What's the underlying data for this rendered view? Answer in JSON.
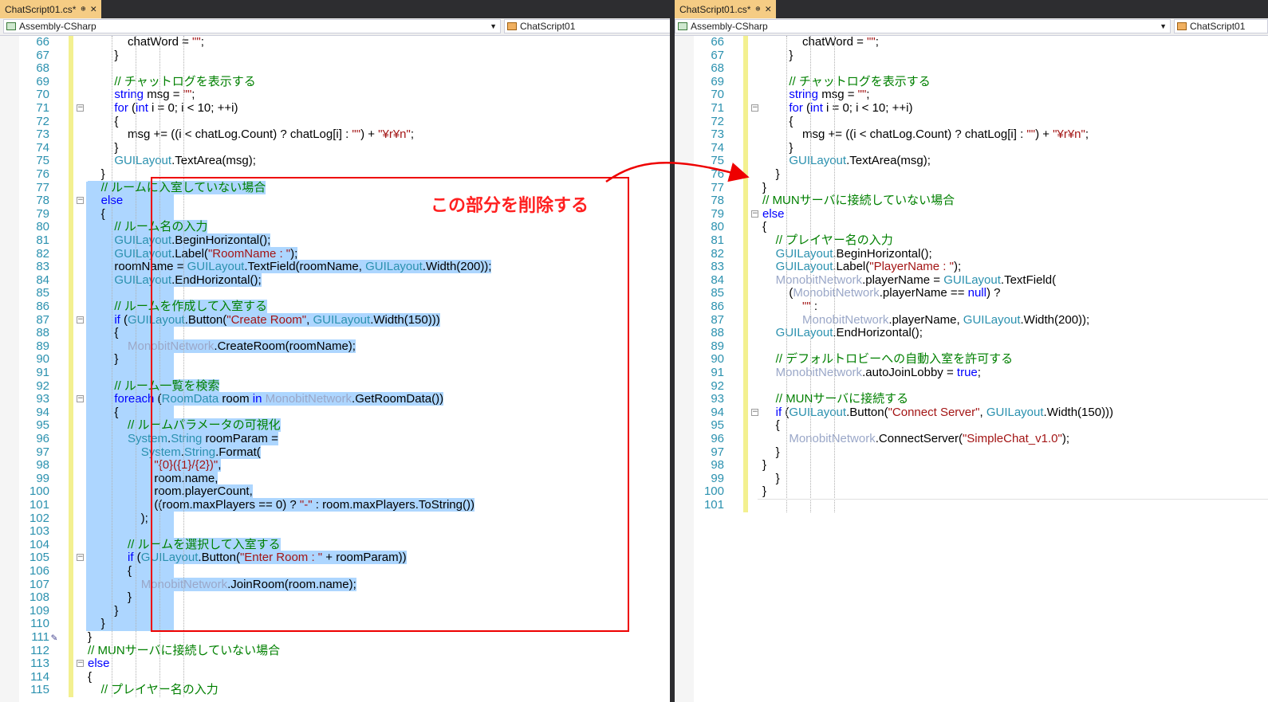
{
  "left": {
    "tab": {
      "title": "ChatScript01.cs*",
      "pin": "⊕",
      "close": "✕"
    },
    "nav": {
      "assembly": "Assembly-CSharp",
      "class": "ChatScript01"
    },
    "lines": [
      {
        "n": "66",
        "t": "            chatWord = \"\";"
      },
      {
        "n": "67",
        "t": "        }"
      },
      {
        "n": "68",
        "t": ""
      },
      {
        "n": "69",
        "t": "        // チャットログを表示する"
      },
      {
        "n": "70",
        "t": "        string msg = \"\";"
      },
      {
        "n": "71",
        "t": "        for (int i = 0; i < 10; ++i)"
      },
      {
        "n": "72",
        "t": "        {"
      },
      {
        "n": "73",
        "t": "            msg += ((i < chatLog.Count) ? chatLog[i] : \"\") + \"¥r¥n\";"
      },
      {
        "n": "74",
        "t": "        }"
      },
      {
        "n": "75",
        "t": "        GUILayout.TextArea(msg);"
      },
      {
        "n": "76",
        "t": "    }"
      },
      {
        "n": "77",
        "t": "    // ルームに入室していない場合"
      },
      {
        "n": "78",
        "t": "    else"
      },
      {
        "n": "79",
        "t": "    {"
      },
      {
        "n": "80",
        "t": "        // ルーム名の入力"
      },
      {
        "n": "81",
        "t": "        GUILayout.BeginHorizontal();"
      },
      {
        "n": "82",
        "t": "        GUILayout.Label(\"RoomName : \");"
      },
      {
        "n": "83",
        "t": "        roomName = GUILayout.TextField(roomName, GUILayout.Width(200));"
      },
      {
        "n": "84",
        "t": "        GUILayout.EndHorizontal();"
      },
      {
        "n": "85",
        "t": ""
      },
      {
        "n": "86",
        "t": "        // ルームを作成して入室する"
      },
      {
        "n": "87",
        "t": "        if (GUILayout.Button(\"Create Room\", GUILayout.Width(150)))"
      },
      {
        "n": "88",
        "t": "        {"
      },
      {
        "n": "89",
        "t": "            MonobitNetwork.CreateRoom(roomName);"
      },
      {
        "n": "90",
        "t": "        }"
      },
      {
        "n": "91",
        "t": ""
      },
      {
        "n": "92",
        "t": "        // ルーム一覧を検索"
      },
      {
        "n": "93",
        "t": "        foreach (RoomData room in MonobitNetwork.GetRoomData())"
      },
      {
        "n": "94",
        "t": "        {"
      },
      {
        "n": "95",
        "t": "            // ルームパラメータの可視化"
      },
      {
        "n": "96",
        "t": "            System.String roomParam ="
      },
      {
        "n": "97",
        "t": "                System.String.Format("
      },
      {
        "n": "98",
        "t": "                    \"{0}({1}/{2})\","
      },
      {
        "n": "99",
        "t": "                    room.name,"
      },
      {
        "n": "100",
        "t": "                    room.playerCount,"
      },
      {
        "n": "101",
        "t": "                    ((room.maxPlayers == 0) ? \"-\" : room.maxPlayers.ToString())"
      },
      {
        "n": "102",
        "t": "                );"
      },
      {
        "n": "103",
        "t": ""
      },
      {
        "n": "104",
        "t": "            // ルームを選択して入室する"
      },
      {
        "n": "105",
        "t": "            if (GUILayout.Button(\"Enter Room : \" + roomParam))"
      },
      {
        "n": "106",
        "t": "            {"
      },
      {
        "n": "107",
        "t": "                MonobitNetwork.JoinRoom(room.name);"
      },
      {
        "n": "108",
        "t": "            }"
      },
      {
        "n": "109",
        "t": "        }"
      },
      {
        "n": "110",
        "t": "    }"
      },
      {
        "n": "111",
        "t": "}"
      },
      {
        "n": "112",
        "t": "// MUNサーバに接続していない場合"
      },
      {
        "n": "113",
        "t": "else"
      },
      {
        "n": "114",
        "t": "{"
      },
      {
        "n": "115",
        "t": "    // プレイヤー名の入力"
      }
    ]
  },
  "right": {
    "tab": {
      "title": "ChatScript01.cs*",
      "pin": "⊕",
      "close": "✕"
    },
    "nav": {
      "assembly": "Assembly-CSharp",
      "class": "ChatScript01"
    },
    "lines": [
      {
        "n": "66",
        "t": "            chatWord = \"\";"
      },
      {
        "n": "67",
        "t": "        }"
      },
      {
        "n": "68",
        "t": ""
      },
      {
        "n": "69",
        "t": "        // チャットログを表示する"
      },
      {
        "n": "70",
        "t": "        string msg = \"\";"
      },
      {
        "n": "71",
        "t": "        for (int i = 0; i < 10; ++i)"
      },
      {
        "n": "72",
        "t": "        {"
      },
      {
        "n": "73",
        "t": "            msg += ((i < chatLog.Count) ? chatLog[i] : \"\") + \"¥r¥n\";"
      },
      {
        "n": "74",
        "t": "        }"
      },
      {
        "n": "75",
        "t": "        GUILayout.TextArea(msg);"
      },
      {
        "n": "76",
        "t": "    }"
      },
      {
        "n": "77",
        "t": "}"
      },
      {
        "n": "78",
        "t": "// MUNサーバに接続していない場合"
      },
      {
        "n": "79",
        "t": "else"
      },
      {
        "n": "80",
        "t": "{"
      },
      {
        "n": "81",
        "t": "    // プレイヤー名の入力"
      },
      {
        "n": "82",
        "t": "    GUILayout.BeginHorizontal();"
      },
      {
        "n": "83",
        "t": "    GUILayout.Label(\"PlayerName : \");"
      },
      {
        "n": "84",
        "t": "    MonobitNetwork.playerName = GUILayout.TextField("
      },
      {
        "n": "85",
        "t": "        (MonobitNetwork.playerName == null) ?"
      },
      {
        "n": "86",
        "t": "            \"\" :"
      },
      {
        "n": "87",
        "t": "            MonobitNetwork.playerName, GUILayout.Width(200));"
      },
      {
        "n": "88",
        "t": "    GUILayout.EndHorizontal();"
      },
      {
        "n": "89",
        "t": ""
      },
      {
        "n": "90",
        "t": "    // デフォルトロビーへの自動入室を許可する"
      },
      {
        "n": "91",
        "t": "    MonobitNetwork.autoJoinLobby = true;"
      },
      {
        "n": "92",
        "t": ""
      },
      {
        "n": "93",
        "t": "    // MUNサーバに接続する"
      },
      {
        "n": "94",
        "t": "    if (GUILayout.Button(\"Connect Server\", GUILayout.Width(150)))"
      },
      {
        "n": "95",
        "t": "    {"
      },
      {
        "n": "96",
        "t": "        MonobitNetwork.ConnectServer(\"SimpleChat_v1.0\");"
      },
      {
        "n": "97",
        "t": "    }"
      },
      {
        "n": "98",
        "t": "}"
      },
      {
        "n": "99",
        "t": "    }"
      },
      {
        "n": "100",
        "t": "}"
      },
      {
        "n": "101",
        "t": ""
      }
    ]
  },
  "annotation": {
    "text": "この部分を削除する",
    "color": "#ff2020"
  },
  "colors": {
    "keyword": "#0000ff",
    "comment": "#008000",
    "string": "#a31515",
    "type": "#2b91af",
    "selection": "#add6ff",
    "tab": "#f5cc84"
  }
}
